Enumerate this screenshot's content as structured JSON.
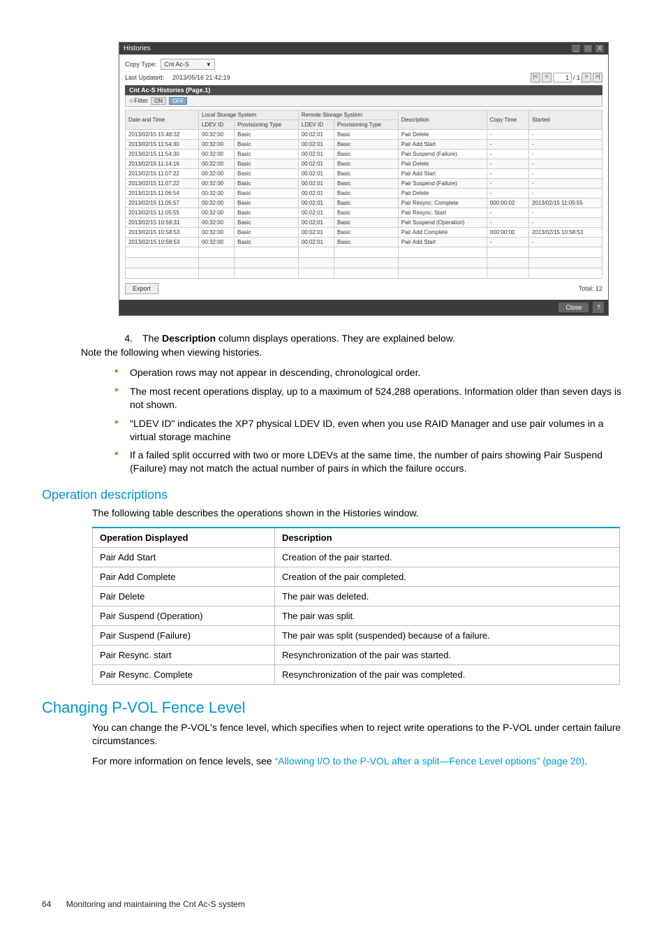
{
  "win": {
    "title": "Histories",
    "copy_type_label": "Copy Type:",
    "copy_type_value": "Cnt Ac-S",
    "last_updated_label": "Last Updated:",
    "last_updated_value": "2013/05/16 21:42:19",
    "pager_page": "1",
    "pager_total": "/ 1",
    "tab_label": "Cnt Ac-S Histories (Page.1)",
    "filter_label": "☆Filter",
    "filter_on": "ON",
    "filter_off": "OFF",
    "group_local": "Local Storage System",
    "group_remote": "Remote Storage System",
    "cols": {
      "dt": "Date and Time",
      "ldev": "LDEV ID",
      "prov": "Provisioning Type",
      "desc": "Description",
      "copy": "Copy Time",
      "started": "Started"
    },
    "rows": [
      {
        "dt": "2013/02/15 15:48:32",
        "lid": "00:32:00",
        "lp": "Basic",
        "rid": "00:02:01",
        "rp": "Basic",
        "d": "Pair Delete",
        "c": "-",
        "s": "-"
      },
      {
        "dt": "2013/02/15 11:54:30",
        "lid": "00:32:00",
        "lp": "Basic",
        "rid": "00:02:01",
        "rp": "Basic",
        "d": "Pair Add Start",
        "c": "-",
        "s": "-"
      },
      {
        "dt": "2013/02/15 11:54:30",
        "lid": "00:32:00",
        "lp": "Basic",
        "rid": "00:02:01",
        "rp": "Basic",
        "d": "Pair Suspend (Failure)",
        "c": "-",
        "s": "-"
      },
      {
        "dt": "2013/02/15 11:14:16",
        "lid": "00:32:00",
        "lp": "Basic",
        "rid": "00:02:01",
        "rp": "Basic",
        "d": "Pair Delete",
        "c": "-",
        "s": "-"
      },
      {
        "dt": "2013/02/15 11:07:22",
        "lid": "00:32:00",
        "lp": "Basic",
        "rid": "00:02:01",
        "rp": "Basic",
        "d": "Pair Add Start",
        "c": "-",
        "s": "-"
      },
      {
        "dt": "2013/02/15 11:07:22",
        "lid": "00:32:00",
        "lp": "Basic",
        "rid": "00:02:01",
        "rp": "Basic",
        "d": "Pair Suspend (Failure)",
        "c": "-",
        "s": "-"
      },
      {
        "dt": "2013/02/15 11:06:54",
        "lid": "00:32:00",
        "lp": "Basic",
        "rid": "00:02:01",
        "rp": "Basic",
        "d": "Pair Delete",
        "c": "-",
        "s": "-"
      },
      {
        "dt": "2013/02/15 11:05:57",
        "lid": "00:32:00",
        "lp": "Basic",
        "rid": "00:02:01",
        "rp": "Basic",
        "d": "Pair Resync. Complete",
        "c": "000:00:02",
        "s": "2013/02/15 11:05:55"
      },
      {
        "dt": "2013/02/15 11:05:55",
        "lid": "00:32:00",
        "lp": "Basic",
        "rid": "00:02:01",
        "rp": "Basic",
        "d": "Pair Resync. Start",
        "c": "-",
        "s": "-"
      },
      {
        "dt": "2013/02/15 10:59:31",
        "lid": "00:32:00",
        "lp": "Basic",
        "rid": "00:02:01",
        "rp": "Basic",
        "d": "Pair Suspend (Operation)",
        "c": "-",
        "s": "-"
      },
      {
        "dt": "2013/02/15 10:58:53",
        "lid": "00:32:00",
        "lp": "Basic",
        "rid": "00:02:01",
        "rp": "Basic",
        "d": "Pair Add Complete",
        "c": "000:00:00",
        "s": "2013/02/15 10:58:53"
      },
      {
        "dt": "2013/02/15 10:58:53",
        "lid": "00:32:00",
        "lp": "Basic",
        "rid": "00:02:01",
        "rp": "Basic",
        "d": "Pair Add Start",
        "c": "-",
        "s": "-"
      }
    ],
    "export": "Export",
    "total_label": "Total: 12",
    "close": "Close",
    "help": "?"
  },
  "body": {
    "li4_num": "4.",
    "li4_a": "The ",
    "li4_b": "Description",
    "li4_c": " column displays operations. They are explained below.",
    "note": "Note the following when viewing histories.",
    "bullets": [
      "Operation rows may not appear in descending, chronological order.",
      "The most recent operations display, up to a maximum of 524,288 operations. Information older than seven days is not shown.",
      "\"LDEV ID\" indicates the XP7 physical LDEV ID, even when you use RAID Manager and use pair volumes in a virtual storage machine",
      "If a failed split occurred with two or more LDEVs at the same time, the number of pairs showing Pair Suspend (Failure) may not match the actual number of pairs in which the failure occurs."
    ],
    "h_opdesc": "Operation descriptions",
    "p_opdesc": "The following table describes the operations shown in the Histories window.",
    "ops_th1": "Operation Displayed",
    "ops_th2": "Description",
    "ops": [
      {
        "o": "Pair Add Start",
        "d": "Creation of the pair started."
      },
      {
        "o": "Pair Add Complete",
        "d": "Creation of the pair completed."
      },
      {
        "o": "Pair Delete",
        "d": "The pair was deleted."
      },
      {
        "o": "Pair Suspend (Operation)",
        "d": "The pair was split."
      },
      {
        "o": "Pair Suspend (Failure)",
        "d": "The pair was split (suspended) because of a failure."
      },
      {
        "o": "Pair Resync. start",
        "d": "Resynchronization of the pair was started."
      },
      {
        "o": "Pair Resync. Complete",
        "d": "Resynchronization of the pair was completed."
      }
    ],
    "h_fence": "Changing P-VOL Fence Level",
    "p_fence1": "You can change the P-VOL's fence level, which specifies when to reject write operations to the P-VOL under certain failure circumstances.",
    "p_fence2a": "For more information on fence levels, see ",
    "p_fence2b": "“Allowing I/O to the P-VOL after a split—Fence Level options” (page 20)",
    "p_fence2c": ".",
    "footer_page": "64",
    "footer_text": "Monitoring and maintaining the Cnt Ac-S system"
  }
}
